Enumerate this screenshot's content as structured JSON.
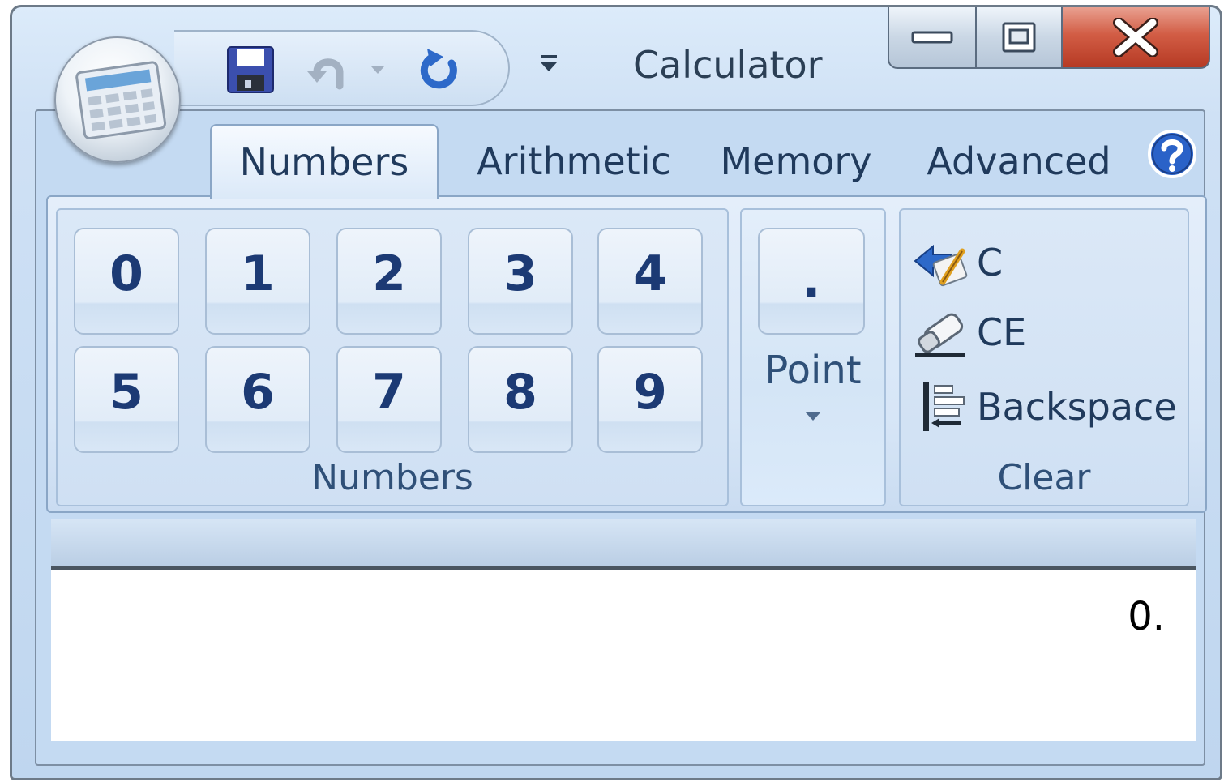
{
  "window": {
    "title": "Calculator"
  },
  "quick_access": {
    "save_icon": "floppy-disk-icon",
    "undo_icon": "undo-arrow-icon",
    "redo_icon": "redo-arrow-icon",
    "customize_icon": "customize-qat-icon"
  },
  "tabs": [
    {
      "label": "Numbers",
      "active": true
    },
    {
      "label": "Arithmetic",
      "active": false
    },
    {
      "label": "Memory",
      "active": false
    },
    {
      "label": "Advanced",
      "active": false
    }
  ],
  "groups": {
    "numbers": {
      "label": "Numbers",
      "digits": [
        "0",
        "1",
        "2",
        "3",
        "4",
        "5",
        "6",
        "7",
        "8",
        "9"
      ]
    },
    "point": {
      "button": ".",
      "label": "Point"
    },
    "clear": {
      "label": "Clear",
      "items": [
        {
          "label": "C",
          "icon": "clear-all-icon"
        },
        {
          "label": "CE",
          "icon": "eraser-icon"
        },
        {
          "label": "Backspace",
          "icon": "backspace-icon"
        }
      ]
    }
  },
  "display": {
    "value": "0."
  },
  "colors": {
    "accent": "#1c3a74",
    "close": "#c8452e",
    "ribbon": "#d7e6f7"
  }
}
